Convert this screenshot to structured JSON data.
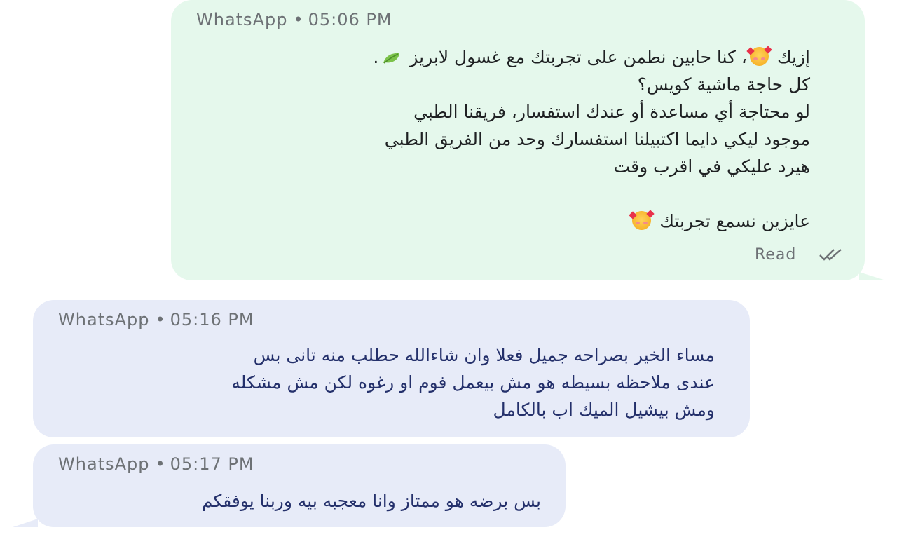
{
  "messages": [
    {
      "direction": "outgoing",
      "source": "WhatsApp",
      "separator": "•",
      "time": "05:06 PM",
      "lines": [
        "إزيك",
        "، كنا حابين نطمن على تجربتك مع غسول لابريز",
        ".",
        "كل حاجة ماشية كويس؟",
        "لو محتاجة أي مساعدة أو عندك استفسار، فريقنا الطبي",
        "موجود ليكي دايما اكتبيلنا استفسارك وحد من الفريق الطبي",
        "هيرد عليكي في اقرب وقت",
        "عايزين نسمع تجربتك"
      ],
      "status": "Read",
      "status_icon": "double-check-icon",
      "emoji": [
        "smiling-face-with-hearts-icon",
        "leaf-icon",
        "smiling-face-with-hearts-icon"
      ]
    },
    {
      "direction": "incoming",
      "source": "WhatsApp",
      "separator": "•",
      "time": "05:16 PM",
      "lines": [
        "مساء الخير بصراحه جميل فعلا وان شاءالله  حطلب منه تانى بس",
        "عندى ملاحظه بسيطه هو مش بيعمل فوم او رغوه لكن مش مشكله",
        "ومش بيشيل الميك اب بالكامل"
      ]
    },
    {
      "direction": "incoming",
      "source": "WhatsApp",
      "separator": "•",
      "time": "05:17 PM",
      "lines": [
        "بس برضه هو ممتاز وانا معجبه بيه وربنا يوفقكم"
      ]
    }
  ],
  "colors": {
    "outgoing_bubble": "#e5f8ec",
    "incoming_bubble": "#e7ebf8",
    "meta_text": "#6d7175",
    "incoming_text": "#24306b",
    "outgoing_text": "#1f2123"
  }
}
